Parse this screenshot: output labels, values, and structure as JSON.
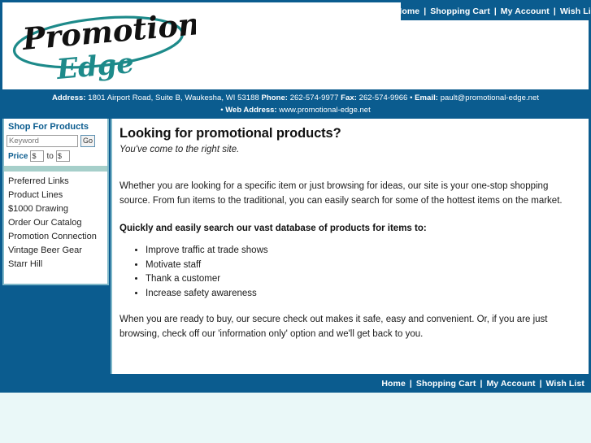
{
  "site": {
    "logo_line1": "Promotional",
    "logo_line2": "Edge"
  },
  "topnav": {
    "items": [
      {
        "label": "Home"
      },
      {
        "label": "Shopping Cart"
      },
      {
        "label": "My Account"
      },
      {
        "label": "Wish List"
      }
    ],
    "separator": "|"
  },
  "contactbar": {
    "address_label": "Address:",
    "address_value": "1801 Airport Road, Suite B, Waukesha, WI 53188",
    "phone_label": "Phone:",
    "phone_value": "262-574-9977",
    "fax_label": "Fax:",
    "fax_value": "262-574-9966",
    "bullet": "•",
    "email_label": "Email:",
    "email_value": "pault@promotional-edge.net",
    "web_label": "Web Address:",
    "web_value": "www.promotional-edge.net"
  },
  "sidebar": {
    "title": "Shop For Products",
    "search": {
      "keyword_placeholder": "Keyword",
      "keyword_value": "",
      "go_label": "Go"
    },
    "price": {
      "label": "Price",
      "min_value": "$",
      "to_label": "to",
      "max_value": "$"
    },
    "items": [
      {
        "label": "Preferred Links"
      },
      {
        "label": "Product Lines"
      },
      {
        "label": "$1000 Drawing"
      },
      {
        "label": "Order Our Catalog"
      },
      {
        "label": "Promotion Connection"
      },
      {
        "label": "Vintage Beer Gear"
      },
      {
        "label": "Starr Hill"
      }
    ]
  },
  "main": {
    "heading": "Looking for promotional products?",
    "subtitle": "You've come to the right site.",
    "paragraph1": "Whether you are looking for a specific item or just browsing for ideas, our site is your one-stop shopping source. From fun items to the traditional, you can easily search for some of the hottest items on the market.",
    "lead": "Quickly and easily search our vast database of products for items to:",
    "bullets": [
      {
        "label": "Improve traffic at trade shows"
      },
      {
        "label": "Motivate staff"
      },
      {
        "label": "Thank a customer"
      },
      {
        "label": "Increase safety awareness"
      }
    ],
    "closing": "When you are ready to buy, our secure check out makes it safe, easy and convenient. Or, if you are just browsing, check off our 'information only' option and we'll get back to you."
  },
  "footernav": {
    "items": [
      {
        "label": "Home"
      },
      {
        "label": "Shopping Cart"
      },
      {
        "label": "My Account"
      },
      {
        "label": "Wish List"
      }
    ],
    "separator": "|"
  },
  "colors": {
    "brand_blue": "#0b5c8f",
    "teal": "#a6cfca",
    "panel_border": "#7fb8c9",
    "page_bottom": "#eaf8f8",
    "logo_teal": "#1d8a8a",
    "logo_black": "#111111"
  }
}
